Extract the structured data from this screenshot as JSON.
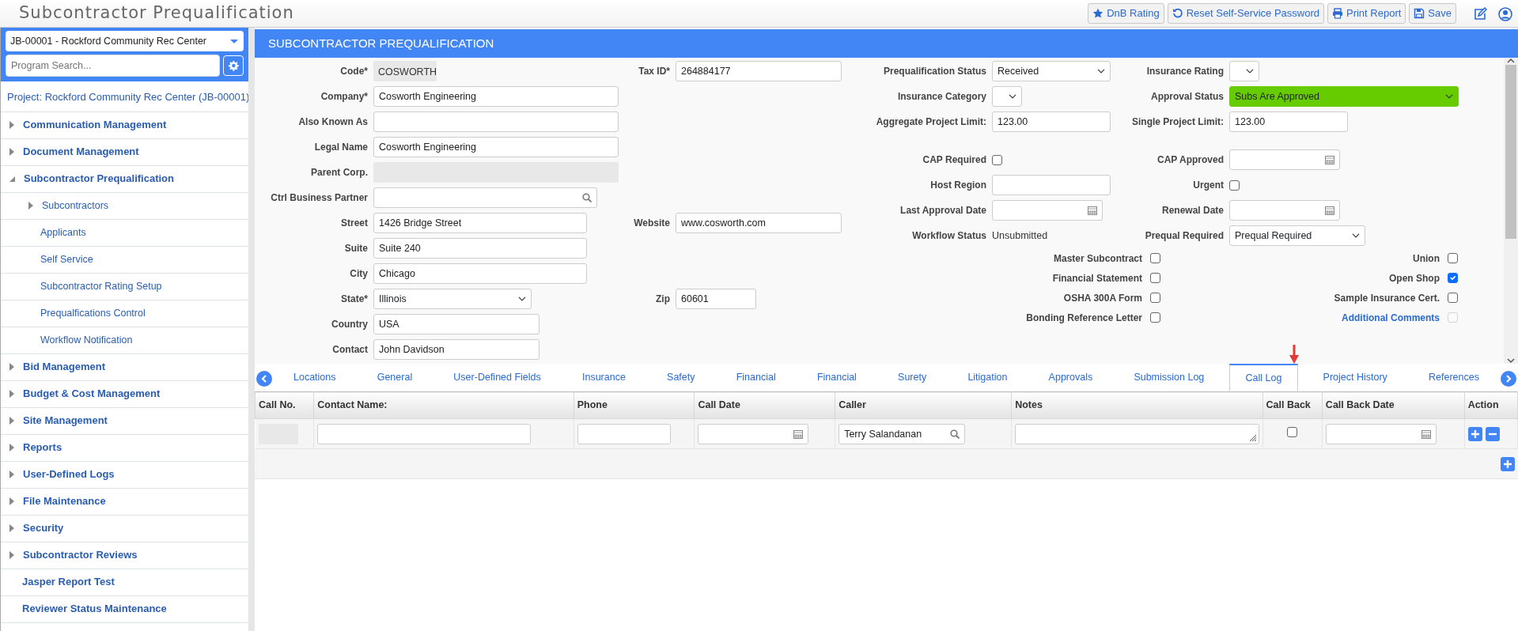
{
  "app_title": "Subcontractor Prequalification",
  "toolbar": [
    {
      "label": "DnB Rating",
      "kind": "star"
    },
    {
      "label": "Reset Self-Service Password",
      "kind": "reset"
    },
    {
      "label": "Print Report",
      "kind": "print"
    },
    {
      "label": "Save",
      "kind": "save"
    }
  ],
  "sidebar": {
    "project_select": "JB-00001 - Rockford Community Rec Center",
    "search": {
      "placeholder": "Program Search..."
    },
    "project_label": "Project: Rockford Community Rec Center (JB-00001)",
    "items": [
      {
        "label": "Communication Management",
        "kind": "group",
        "expanded": false
      },
      {
        "label": "Document Management",
        "kind": "group",
        "expanded": false
      },
      {
        "label": "Subcontractor Prequalification",
        "kind": "group",
        "expanded": true,
        "children": [
          {
            "label": "Subcontractors",
            "kind": "group",
            "expanded": false
          },
          {
            "label": "Applicants",
            "kind": "link"
          },
          {
            "label": "Self Service",
            "kind": "link"
          },
          {
            "label": "Subcontractor Rating Setup",
            "kind": "link"
          },
          {
            "label": "Prequalfications Control",
            "kind": "link"
          },
          {
            "label": "Workflow Notification",
            "kind": "link"
          }
        ]
      },
      {
        "label": "Bid Management",
        "kind": "group",
        "expanded": false
      },
      {
        "label": "Budget & Cost Management",
        "kind": "group",
        "expanded": false
      },
      {
        "label": "Site Management",
        "kind": "group",
        "expanded": false
      },
      {
        "label": "Reports",
        "kind": "group",
        "expanded": false
      },
      {
        "label": "User-Defined Logs",
        "kind": "group",
        "expanded": false
      },
      {
        "label": "File Maintenance",
        "kind": "group",
        "expanded": false
      },
      {
        "label": "Security",
        "kind": "group",
        "expanded": false
      },
      {
        "label": "Subcontractor Reviews",
        "kind": "group",
        "expanded": false
      },
      {
        "label": "Jasper Report Test",
        "kind": "link"
      },
      {
        "label": "Reviewer Status Maintenance",
        "kind": "link"
      }
    ]
  },
  "form": {
    "title": "SUBCONTRACTOR PREQUALIFICATION",
    "left_rows": [
      {
        "label": "Code*",
        "field": {
          "kind": "readonly",
          "value": "COSWORTH"
        },
        "extra": {
          "label": "Tax ID*",
          "field": {
            "kind": "text",
            "value": "264884177"
          }
        }
      },
      {
        "label": "Company*",
        "field": {
          "kind": "text",
          "value": "Cosworth Engineering"
        }
      },
      {
        "label": "Also Known As",
        "field": {
          "kind": "text"
        }
      },
      {
        "label": "Legal Name",
        "field": {
          "kind": "text",
          "value": "Cosworth Engineering"
        }
      },
      {
        "label": "Parent Corp.",
        "field": {
          "kind": "readonly"
        }
      },
      {
        "label": "Ctrl Business Partner",
        "field": {
          "kind": "lookup"
        }
      },
      {
        "label": "Street",
        "field": {
          "kind": "text",
          "value": "1426 Bridge Street"
        },
        "extra": {
          "label": "Website",
          "field": {
            "kind": "text",
            "value": "www.cosworth.com"
          }
        }
      },
      {
        "label": "Suite",
        "field": {
          "kind": "text",
          "value": "Suite 240"
        }
      },
      {
        "label": "City",
        "field": {
          "kind": "text",
          "value": "Chicago"
        }
      },
      {
        "label": "State*",
        "field": {
          "kind": "select",
          "value": "Illinois"
        },
        "extra": {
          "label": "Zip",
          "field": {
            "kind": "text",
            "value": "60601"
          }
        }
      },
      {
        "label": "Country",
        "field": {
          "kind": "text",
          "value": "USA"
        }
      },
      {
        "label": "Contact",
        "field": {
          "kind": "text",
          "value": "John Davidson"
        }
      }
    ],
    "right_sections": [
      {
        "rows": [
          {
            "a": {
              "label": "Prequalification Status",
              "field": {
                "kind": "select",
                "value": "Received"
              }
            },
            "b": {
              "label": "Insurance Rating",
              "field": {
                "kind": "select"
              }
            }
          },
          {
            "a": {
              "label": "Insurance Category",
              "field": {
                "kind": "select"
              }
            },
            "b": {
              "label": "Approval Status",
              "field": {
                "kind": "select",
                "value": "Subs Are Approved",
                "color": "#66cc00"
              }
            }
          },
          {
            "a": {
              "label": "Aggregate Project Limit:",
              "field": {
                "kind": "text",
                "value": "123.00"
              }
            },
            "b": {
              "label": "Single Project Limit:",
              "field": {
                "kind": "text",
                "value": "123.00"
              }
            }
          }
        ]
      },
      {
        "rows": [
          {
            "a": {
              "label": "CAP Required",
              "field": {
                "kind": "checkbox",
                "checked": false
              }
            },
            "b": {
              "label": "CAP Approved",
              "field": {
                "kind": "date"
              }
            }
          },
          {
            "a": {
              "label": "Host Region",
              "field": {
                "kind": "text"
              }
            },
            "b": {
              "label": "Urgent",
              "field": {
                "kind": "checkbox",
                "checked": false
              }
            }
          },
          {
            "a": {
              "label": "Last Approval Date",
              "field": {
                "kind": "date"
              }
            },
            "b": {
              "label": "Renewal Date",
              "field": {
                "kind": "date"
              }
            }
          },
          {
            "a": {
              "label": "Workflow Status",
              "field": {
                "kind": "static",
                "value": "Unsubmitted"
              }
            },
            "b": {
              "label": "Prequal Required",
              "field": {
                "kind": "select",
                "value": "Prequal Required"
              }
            }
          }
        ]
      }
    ],
    "checkbox_rows": [
      [
        {
          "label": "Master Subcontract",
          "kind": "plain",
          "checked": false,
          "disabled": false
        },
        {
          "label": "Union",
          "kind": "plain",
          "checked": false,
          "disabled": false
        }
      ],
      [
        {
          "label": "Financial Statement",
          "kind": "plain",
          "checked": false,
          "disabled": false
        },
        {
          "label": "Open Shop",
          "kind": "plain",
          "checked": true,
          "disabled": false
        }
      ],
      [
        {
          "label": "OSHA 300A Form",
          "kind": "plain",
          "checked": false,
          "disabled": false
        },
        {
          "label": "Sample Insurance Cert.",
          "kind": "plain",
          "checked": false,
          "disabled": false
        }
      ],
      [
        {
          "label": "Bonding Reference Letter",
          "kind": "plain",
          "checked": false,
          "disabled": false
        },
        {
          "label": "Additional Comments",
          "kind": "link",
          "checked": false,
          "disabled": true
        }
      ]
    ]
  },
  "tabs": [
    {
      "label": "Locations",
      "selected": false
    },
    {
      "label": "General",
      "selected": false
    },
    {
      "label": "User-Defined Fields",
      "selected": false
    },
    {
      "label": "Insurance",
      "selected": false
    },
    {
      "label": "Safety",
      "selected": false
    },
    {
      "label": "Financial",
      "selected": false
    },
    {
      "label": "Financial",
      "selected": false
    },
    {
      "label": "Surety",
      "selected": false
    },
    {
      "label": "Litigation",
      "selected": false
    },
    {
      "label": "Approvals",
      "selected": false
    },
    {
      "label": "Submission Log",
      "selected": false
    },
    {
      "label": "Call Log",
      "selected": true
    },
    {
      "label": "Project History",
      "selected": false
    },
    {
      "label": "References",
      "selected": false
    }
  ],
  "table": {
    "columns": [
      "Call No.",
      "Contact Name:",
      "Phone",
      "Call Date",
      "Caller",
      "Notes",
      "Call Back",
      "Call Back Date",
      "Action"
    ],
    "rows": [
      {
        "cells": [
          {
            "kind": "readonly"
          },
          {
            "kind": "text"
          },
          {
            "kind": "text"
          },
          {
            "kind": "date"
          },
          {
            "kind": "lookup",
            "value": "Terry Salandanan"
          },
          {
            "kind": "textarea"
          },
          {
            "kind": "checkbox",
            "checked": false
          },
          {
            "kind": "date"
          },
          {
            "kind": "actions"
          }
        ]
      }
    ]
  }
}
